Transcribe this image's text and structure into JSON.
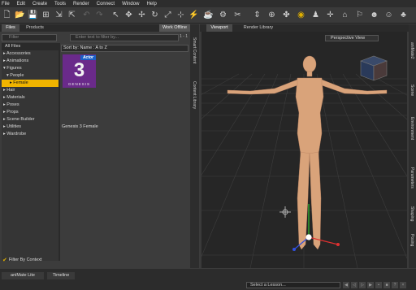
{
  "menu": [
    "File",
    "Edit",
    "Create",
    "Tools",
    "Render",
    "Connect",
    "Window",
    "Help"
  ],
  "left_tabs": {
    "files": "Files",
    "products": "Products",
    "work_offline": "Work Offline"
  },
  "search": {
    "product_filter_placeholder": "Filter",
    "placeholder": "Enter text to filter by...",
    "page": "1 - 1"
  },
  "sort": "Sort by: Name : A to Z",
  "tree": {
    "all_files": "All Files",
    "items": [
      "Accessories",
      "Animations",
      "Figures",
      "People",
      "Female",
      "Hair",
      "Materials",
      "Poses",
      "Props",
      "Scene Builder",
      "Utilities",
      "Wardrobe"
    ]
  },
  "thumb": {
    "badge": "Actor",
    "number": "3",
    "brand": "GENESIS",
    "caption": "Genesis 3 Female"
  },
  "filter_by_context": "Filter By Context",
  "left_vtabs": [
    "Smart Content",
    "Content Library"
  ],
  "viewport_tabs": {
    "viewport": "Viewport",
    "render_library": "Render Library"
  },
  "view_select": "Perspective View",
  "right_vtabs": [
    "aniMate2",
    "Scene",
    "Environment",
    "Parameters",
    "Shaping",
    "Posing"
  ],
  "bottom": {
    "animate": "aniMate Lite",
    "timeline": "Timeline",
    "lesson": "Select a Lesson..."
  },
  "colors": {
    "accent": "#f0b400",
    "thumb_bg": "#6a2a8a",
    "actor_badge": "#1a5fc7"
  }
}
